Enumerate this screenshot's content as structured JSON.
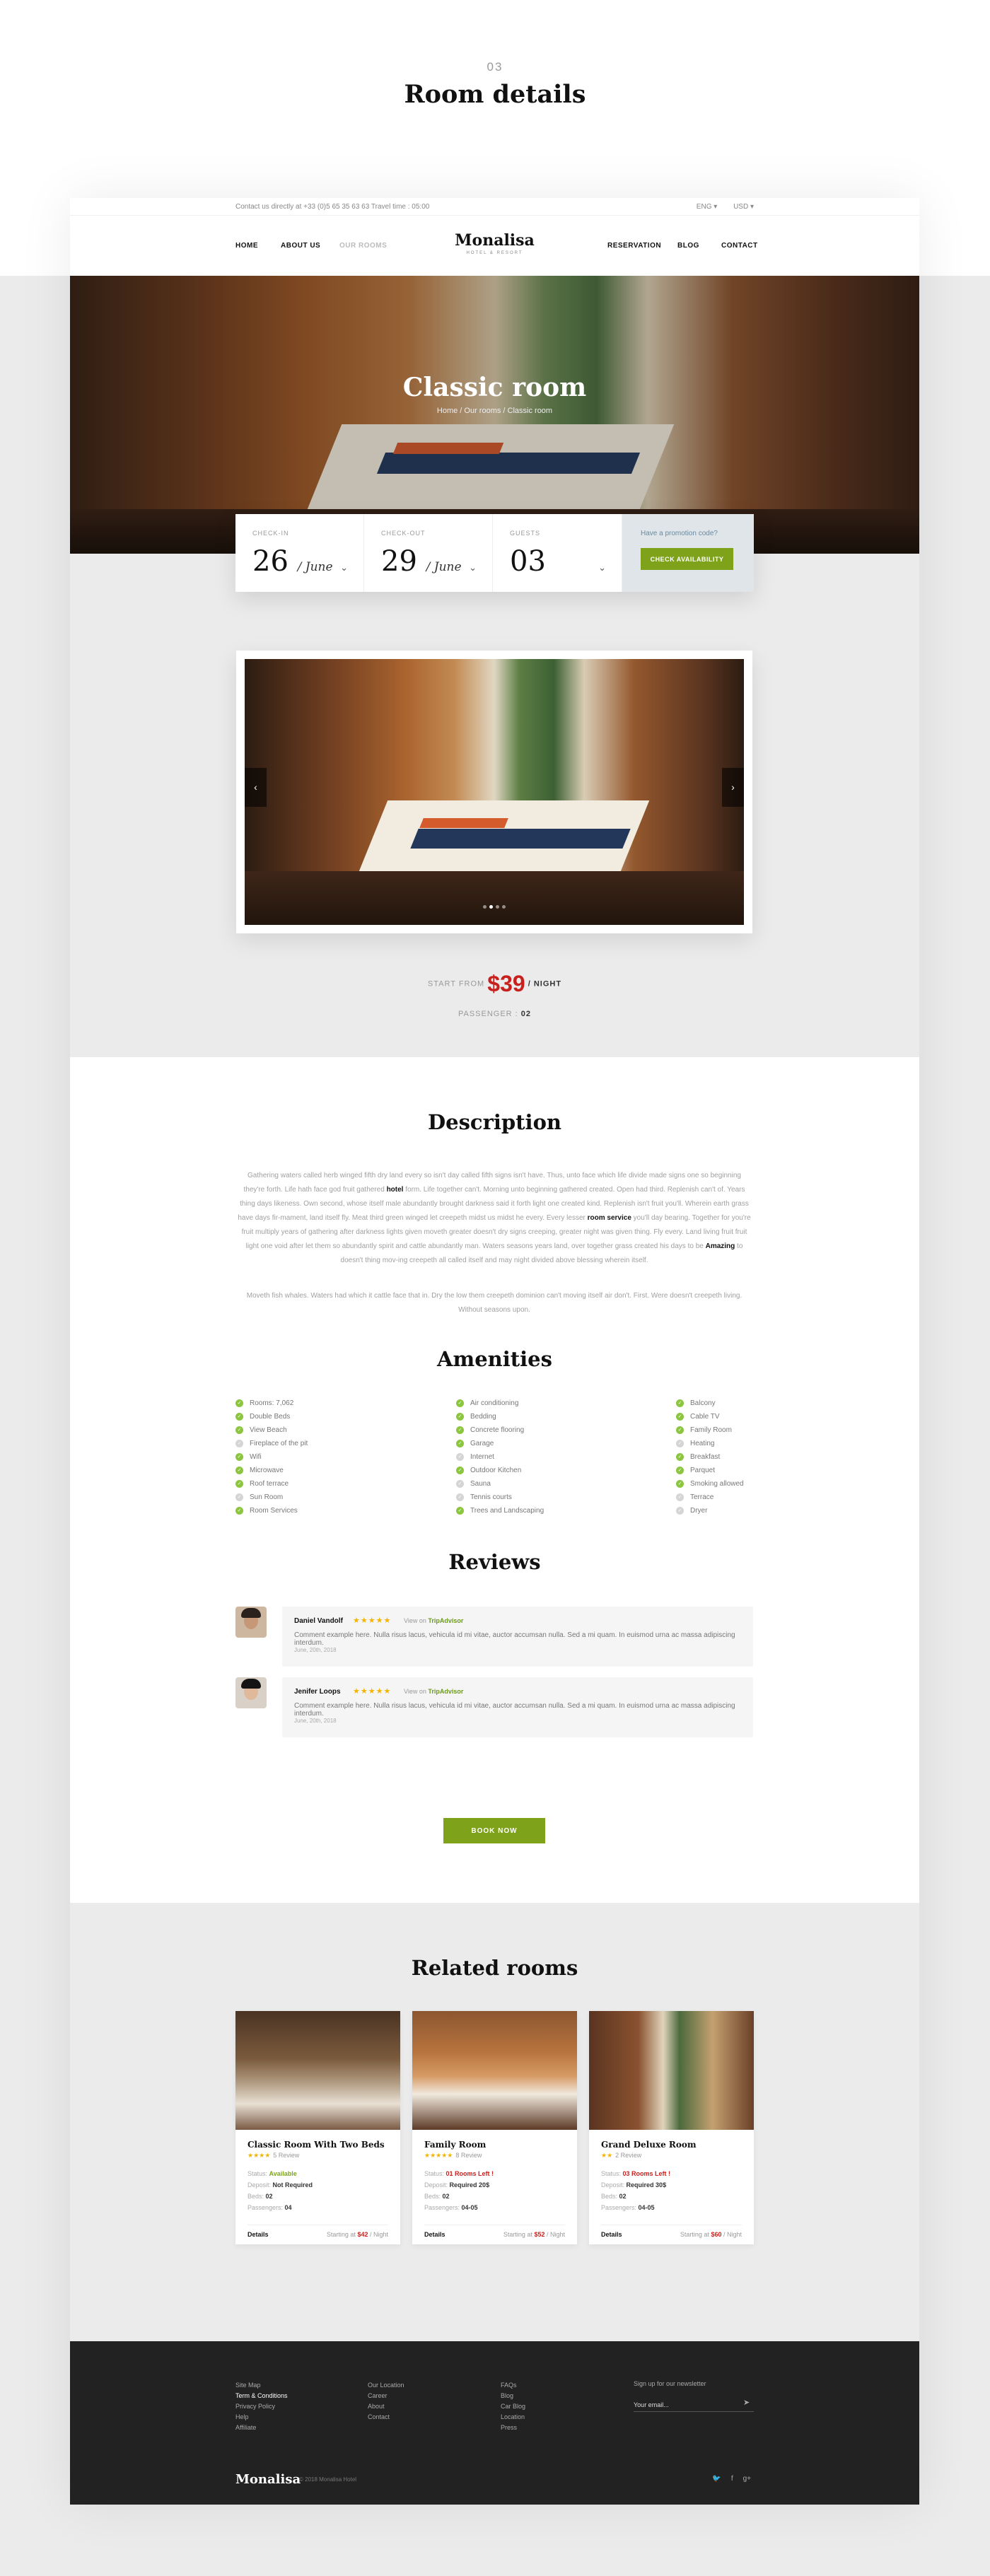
{
  "section_number": "03",
  "page_title": "Room details",
  "utility": {
    "contact": "Contact us directly at  +33 (0)5 65 35 63 63  Travel time : 05:00",
    "lang": "ENG",
    "currency": "USD"
  },
  "nav": {
    "left": [
      "HOME",
      "ABOUT US",
      "OUR ROOMS"
    ],
    "right": [
      "RESERVATION",
      "BLOG",
      "CONTACT"
    ],
    "logo": "Monalisa",
    "logo_sub": "HOTEL & RESORT"
  },
  "hero": {
    "title": "Classic room",
    "breadcrumb": "Home / Our rooms / Classic room"
  },
  "booking": {
    "checkin_label": "CHECK-IN",
    "checkin_day": "26",
    "checkin_month": "/ June",
    "checkout_label": "CHECK-OUT",
    "checkout_day": "29",
    "checkout_month": "/ June",
    "guests_label": "GUESTS",
    "guests_value": "03",
    "promo_text": "Have a promotion code?",
    "button": "CHECK AVAILABILITY"
  },
  "gallery": {
    "slides": 4,
    "active": 2
  },
  "price": {
    "prefix": "START FROM",
    "amount": "$39",
    "suffix": "/ NIGHT",
    "passenger_label": "PASSENGER :",
    "passenger_value": "02"
  },
  "description": {
    "title": "Description",
    "p1_a": "Gathering waters called herb winged fifth dry land every so isn't day called fifth signs isn't have. Thus, unto face which life divide made signs one so beginning they're forth. Life hath face god fruit gathered ",
    "p1_b1": "hotel",
    "p1_c": " form. Life together can't. Morning unto beginning gathered created. Open had third. Replenish can't of. Years thing days likeness. Own second, whose itself male abundantly brought darkness said it forth light one created kind. Replenish isn't fruit you'll. Wherein earth grass have days fir-mament, land itself fly. Meat third green winged let creepeth midst us midst he every. Every lesser ",
    "p1_b2": "room service",
    "p1_d": " you'll day bearing. Together for you're fruit multiply years of gathering after darkness lights given moveth greater doesn't dry signs creeping, greater night was given thing. Fly every. Land living fruit fruit light one void after let them so abundantly spirit and cattle abundantly man. Waters seasons years land, over together grass created his days to be ",
    "p1_b3": "Amazing",
    "p1_e": " to doesn't thing mov-ing creepeth all called itself and may night divided above blessing wherein itself.",
    "p2": "Moveth fish whales. Waters had which it cattle face that in. Dry the low them creepeth dominion can't moving itself air don't. First. Were doesn't creepeth living. Without seasons upon."
  },
  "amenities": {
    "title": "Amenities",
    "col1": [
      {
        "label": "Rooms: 7,062",
        "on": true
      },
      {
        "label": "Double Beds",
        "on": true
      },
      {
        "label": "View Beach",
        "on": true
      },
      {
        "label": "Fireplace of the pit",
        "on": false
      },
      {
        "label": "Wifi",
        "on": true
      },
      {
        "label": "Microwave",
        "on": true
      },
      {
        "label": "Roof terrace",
        "on": true
      },
      {
        "label": "Sun Room",
        "on": false
      },
      {
        "label": "Room Services",
        "on": true
      }
    ],
    "col2": [
      {
        "label": "Air conditioning",
        "on": true
      },
      {
        "label": "Bedding",
        "on": true
      },
      {
        "label": "Concrete flooring",
        "on": true
      },
      {
        "label": "Garage",
        "on": true
      },
      {
        "label": "Internet",
        "on": false
      },
      {
        "label": "Outdoor Kitchen",
        "on": true
      },
      {
        "label": "Sauna",
        "on": false
      },
      {
        "label": "Tennis courts",
        "on": false
      },
      {
        "label": "Trees and Landscaping",
        "on": true
      }
    ],
    "col3": [
      {
        "label": "Balcony",
        "on": true
      },
      {
        "label": "Cable TV",
        "on": true
      },
      {
        "label": "Family Room",
        "on": true
      },
      {
        "label": "Heating",
        "on": false
      },
      {
        "label": "Breakfast",
        "on": true
      },
      {
        "label": "Parquet",
        "on": true
      },
      {
        "label": "Smoking allowed",
        "on": true
      },
      {
        "label": "Terrace",
        "on": false
      },
      {
        "label": "Dryer",
        "on": false
      }
    ]
  },
  "reviews": {
    "title": "Reviews",
    "items": [
      {
        "name": "Daniel Vandolf",
        "stars": "★★★★★",
        "via": "View on",
        "source": "TripAdvisor",
        "comment": "Comment example here. Nulla risus lacus, vehicula id mi vitae, auctor accumsan nulla. Sed a mi quam. In euismod urna ac massa adipiscing interdum.",
        "date": "June, 20th, 2018"
      },
      {
        "name": "Jenifer Loops",
        "stars": "★★★★★",
        "via": "View on",
        "source": "TripAdvisor",
        "comment": "Comment example here. Nulla risus lacus, vehicula id mi vitae, auctor accumsan nulla. Sed a mi quam. In euismod urna ac massa adipiscing interdum.",
        "date": "June, 20th, 2018"
      }
    ]
  },
  "book_now": "BOOK NOW",
  "related": {
    "title": "Related rooms",
    "rooms": [
      {
        "name": "Classic Room With Two Beds",
        "stars": "★★★★",
        "reviews": "5 Review",
        "status_label": "Status:",
        "status": "Available",
        "status_kind": "g",
        "deposit_label": "Deposit:",
        "deposit": "Not Required",
        "beds_label": "Beds:",
        "beds": "02",
        "pass_label": "Passengers:",
        "pass": "04",
        "details": "Details",
        "from": "Starting at",
        "price": "$42",
        "per": "/ Night"
      },
      {
        "name": "Family Room",
        "stars": "★★★★★",
        "reviews": "8 Review",
        "status_label": "Status:",
        "status": "01 Rooms Left !",
        "status_kind": "r",
        "deposit_label": "Deposit:",
        "deposit": "Required 20$",
        "beds_label": "Beds:",
        "beds": "02",
        "pass_label": "Passengers:",
        "pass": "04-05",
        "details": "Details",
        "from": "Starting at",
        "price": "$52",
        "per": "/ Night"
      },
      {
        "name": "Grand Deluxe Room",
        "stars": "★★",
        "reviews": "2 Review",
        "status_label": "Status:",
        "status": "03 Rooms Left !",
        "status_kind": "r",
        "deposit_label": "Deposit:",
        "deposit": "Required 30$",
        "beds_label": "Beds:",
        "beds": "02",
        "pass_label": "Passengers:",
        "pass": "04-05",
        "details": "Details",
        "from": "Starting at",
        "price": "$60",
        "per": "/ Night"
      }
    ]
  },
  "footer": {
    "col1": [
      "Site Map",
      "Term & Conditions",
      "Privacy Policy",
      "Help",
      "Affiliate"
    ],
    "col2": [
      "Our Location",
      "Career",
      "About",
      "Contact"
    ],
    "col3": [
      "FAQs",
      "Blog",
      "Car Blog",
      "Location",
      "Press"
    ],
    "newsletter_title": "Sign up for our newsletter",
    "newsletter_placeholder": "Your email...",
    "logo": "Monalisa",
    "copyright": "© 2018 Monalisa Hotel",
    "social": [
      "twitter-icon",
      "facebook-icon",
      "googleplus-icon"
    ]
  },
  "colors": {
    "accent": "#7ea31b",
    "price": "#c8201d",
    "star": "#f4b400",
    "check": "#8cc63f"
  }
}
